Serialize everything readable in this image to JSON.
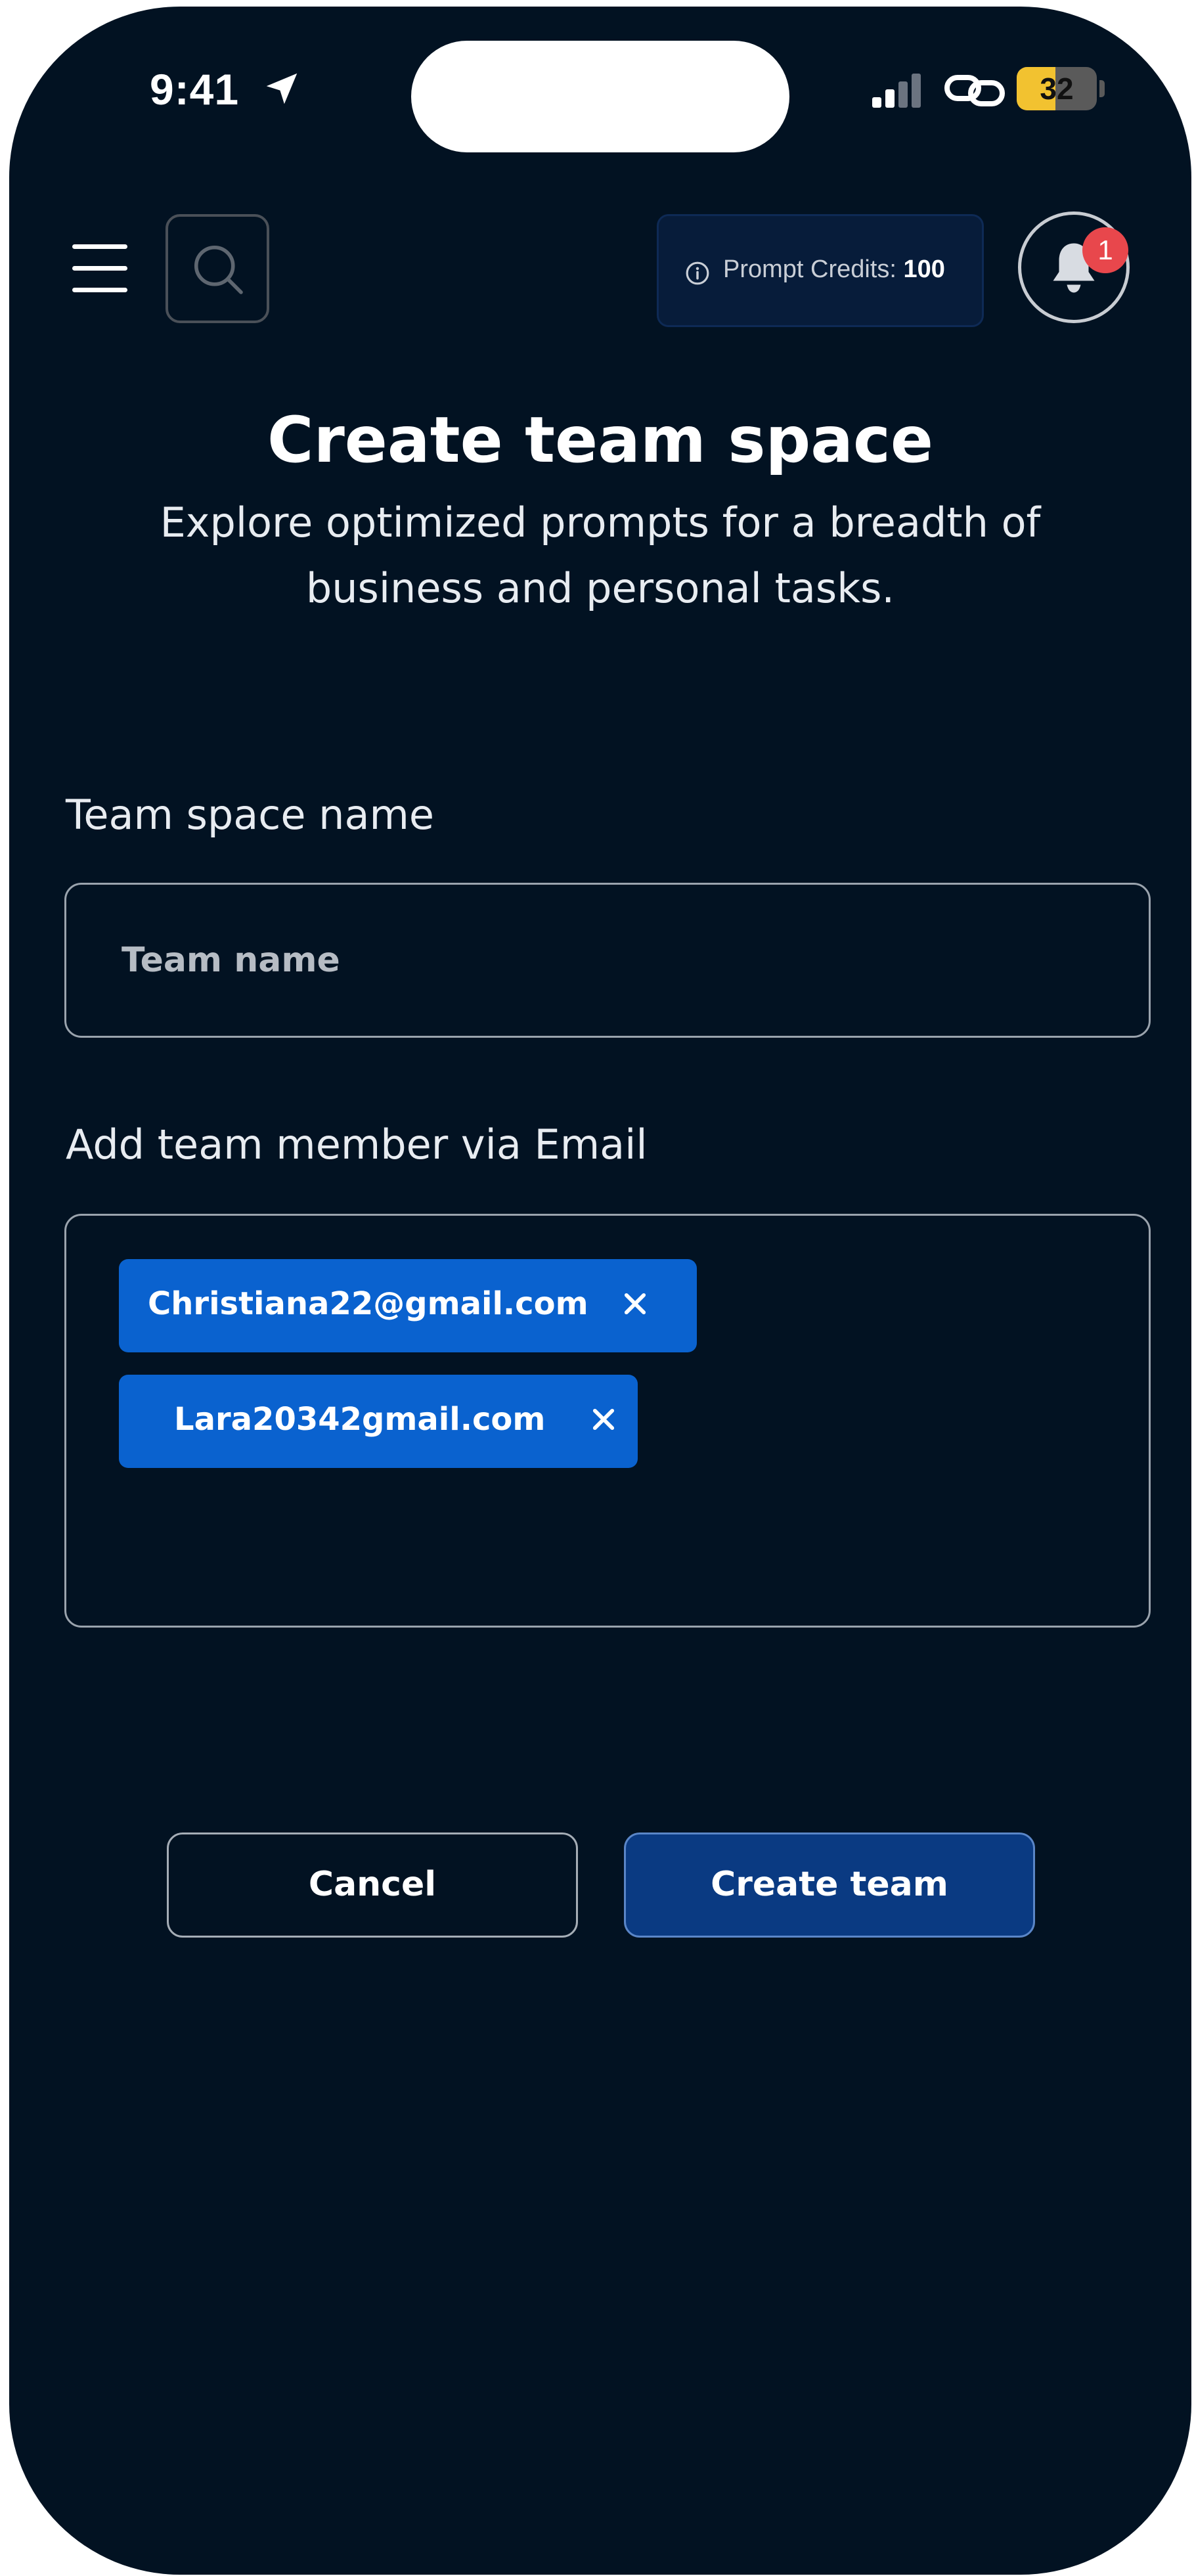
{
  "status_bar": {
    "time": "9:41",
    "battery_level": "32"
  },
  "header": {
    "credits_label": "Prompt Credits:",
    "credits_value": "100",
    "notification_count": "1"
  },
  "page": {
    "title": "Create team space",
    "subtitle": "Explore optimized prompts for a breadth of business and personal tasks."
  },
  "form": {
    "team_name_label": "Team space name",
    "team_name_placeholder": "Team name",
    "team_name_value": "",
    "email_label": "Add team member via Email",
    "emails": [
      "Christiana22@gmail.com",
      "Lara20342gmail.com"
    ]
  },
  "actions": {
    "cancel_label": "Cancel",
    "create_label": "Create team"
  },
  "colors": {
    "background": "#021222",
    "chip": "#0a62cf",
    "primary_button": "#0a3a82",
    "badge": "#e8474c",
    "battery": "#f2c230"
  }
}
